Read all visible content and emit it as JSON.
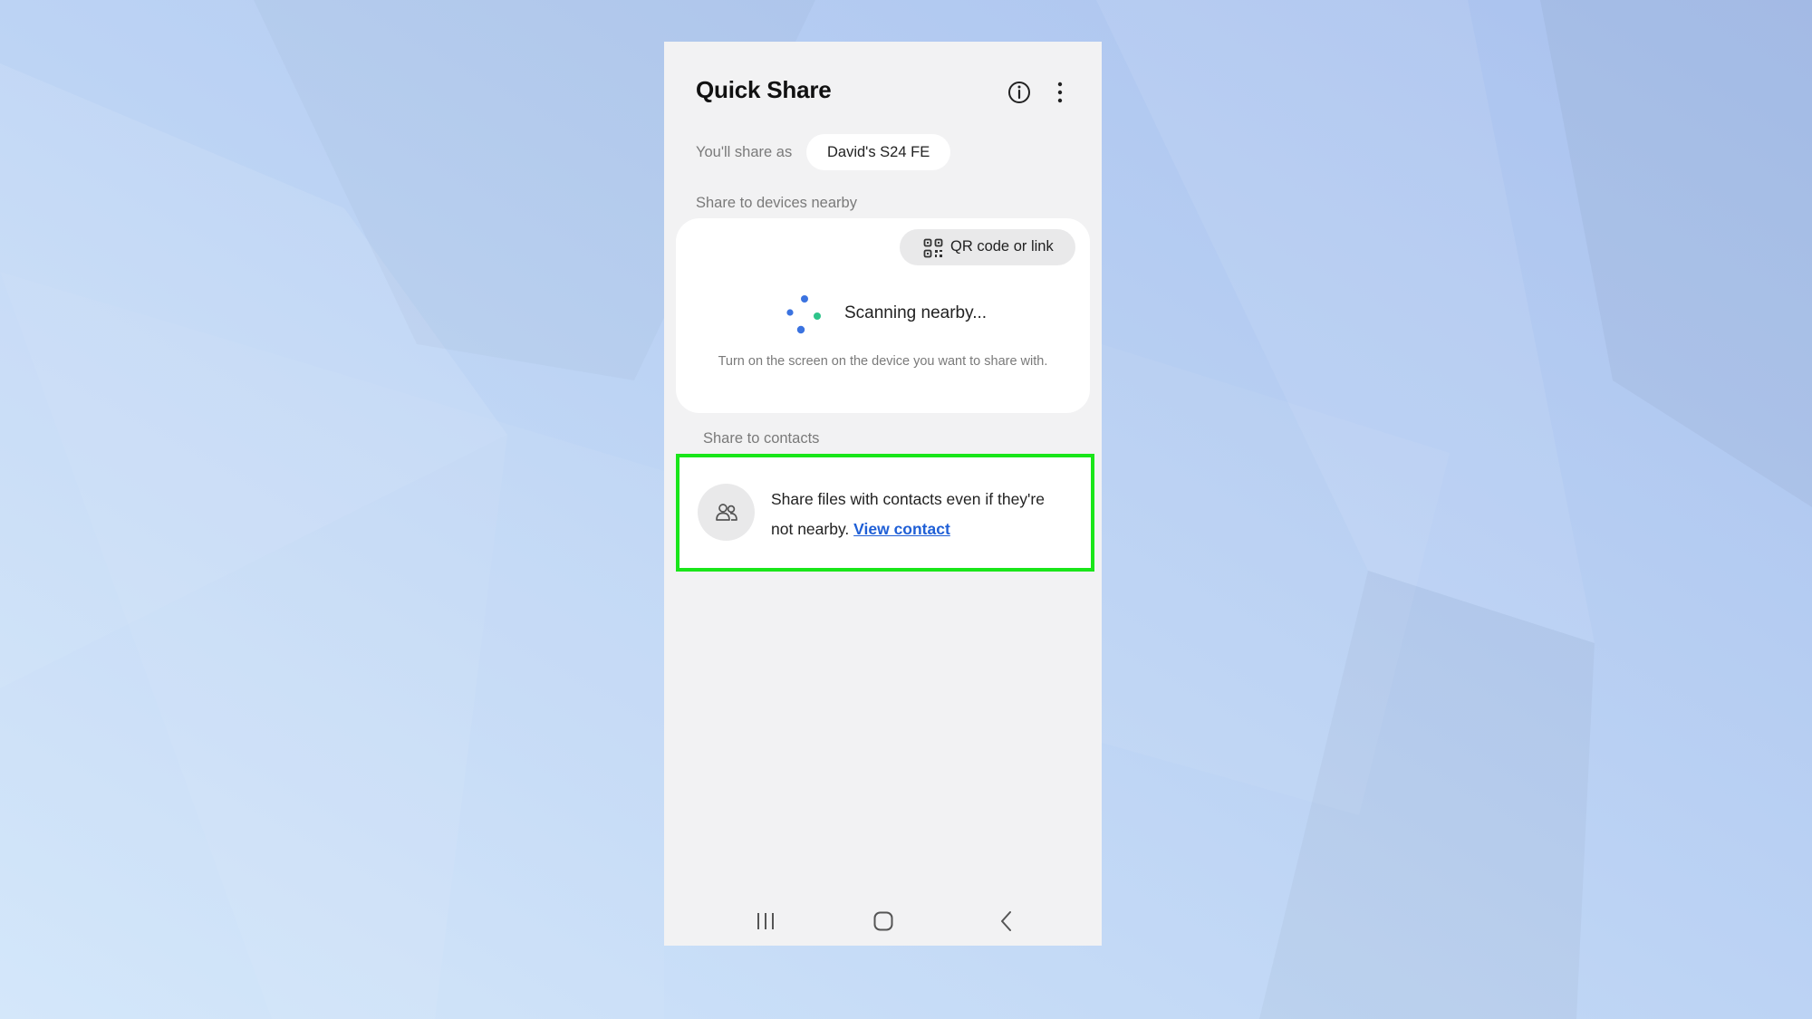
{
  "background": {
    "colors": [
      "#d2e6fa",
      "#bcd3f4",
      "#a9c1ee"
    ]
  },
  "app": {
    "title": "Quick Share"
  },
  "header": {
    "icons": [
      "info-icon",
      "more-vert-icon"
    ]
  },
  "share_as": {
    "label": "You'll share as",
    "device_name_bold": "David's S24 FE"
  },
  "nearby": {
    "section_label": "Share to devices nearby",
    "qr_button": {
      "icon": "qr-code-icon",
      "label": "QR code or link"
    },
    "scan_status": "Scanning nearby...",
    "scan_hint": "Turn on the screen on the device you want to share with.",
    "scan_colors": [
      "#3b73e0",
      "#2ec48a"
    ]
  },
  "contacts": {
    "section_label": "Share to contacts",
    "icon": "people-icon",
    "description": "Share files with contacts even if they're not nearby.",
    "link_label": "View contact",
    "highlight_color": "#19e619",
    "link_color": "#1f5fd6"
  },
  "navbar": {
    "buttons": [
      "recents-icon",
      "home-icon",
      "back-icon"
    ]
  }
}
